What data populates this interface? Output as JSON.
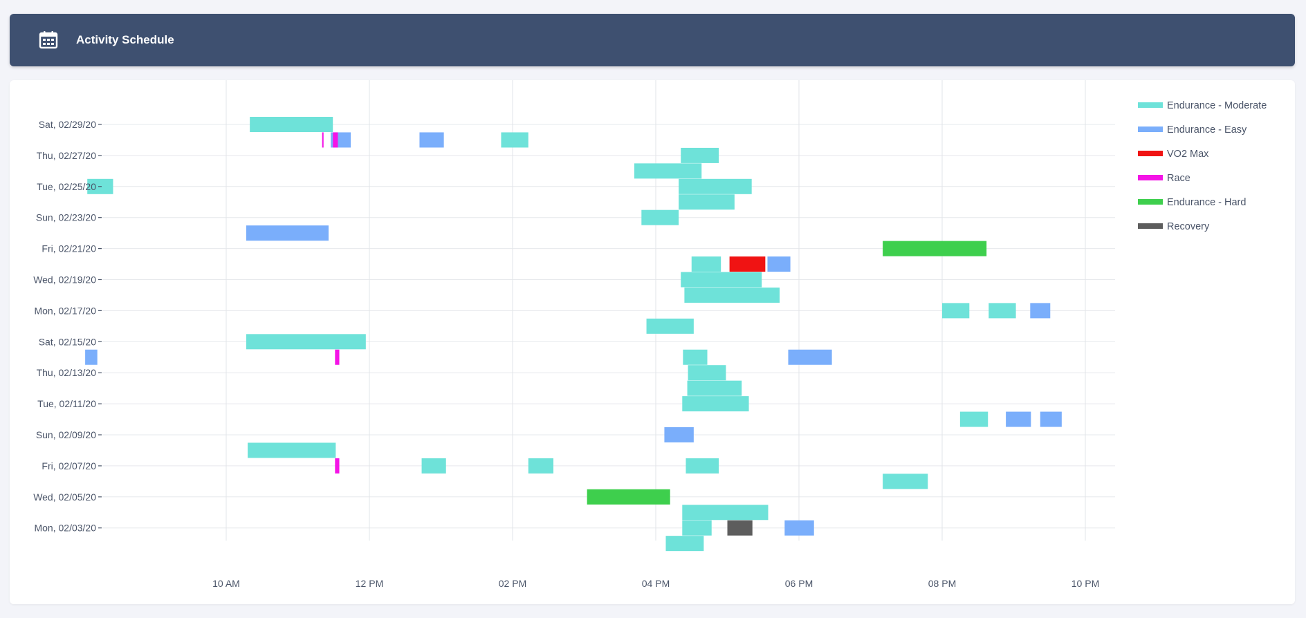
{
  "header": {
    "title": "Activity Schedule",
    "icon": "calendar-icon"
  },
  "chart_data": {
    "type": "timeline",
    "title": "",
    "xlabel": "",
    "ylabel": "",
    "x_unit": "hour of day",
    "x_ticks": [
      {
        "hour": 10,
        "label": "10 AM"
      },
      {
        "hour": 12,
        "label": "12 PM"
      },
      {
        "hour": 14,
        "label": "02 PM"
      },
      {
        "hour": 16,
        "label": "04 PM"
      },
      {
        "hour": 18,
        "label": "06 PM"
      },
      {
        "hour": 20,
        "label": "08 PM"
      },
      {
        "hour": 22,
        "label": "10 PM"
      }
    ],
    "xlim": [
      7,
      22.4
    ],
    "y_categories": [
      "Sat, 02/29/20",
      "Fri, 02/28/20",
      "Thu, 02/27/20",
      "Wed, 02/26/20",
      "Tue, 02/25/20",
      "Mon, 02/24/20",
      "Sun, 02/23/20",
      "Sat, 02/22/20",
      "Fri, 02/21/20",
      "Thu, 02/20/20",
      "Wed, 02/19/20",
      "Tue, 02/18/20",
      "Mon, 02/17/20",
      "Sun, 02/16/20",
      "Sat, 02/15/20",
      "Fri, 02/14/20",
      "Thu, 02/13/20",
      "Wed, 02/12/20",
      "Tue, 02/11/20",
      "Mon, 02/10/20",
      "Sun, 02/09/20",
      "Sat, 02/08/20",
      "Fri, 02/07/20",
      "Thu, 02/06/20",
      "Wed, 02/05/20",
      "Tue, 02/04/20",
      "Mon, 02/03/20",
      "Sun, 02/02/20"
    ],
    "y_tick_labels": [
      "Sat, 02/29/20",
      "Thu, 02/27/20",
      "Tue, 02/25/20",
      "Sun, 02/23/20",
      "Fri, 02/21/20",
      "Wed, 02/19/20",
      "Mon, 02/17/20",
      "Sat, 02/15/20",
      "Thu, 02/13/20",
      "Tue, 02/11/20",
      "Sun, 02/09/20",
      "Fri, 02/07/20",
      "Wed, 02/05/20",
      "Mon, 02/03/20"
    ],
    "legend_position": "right",
    "grid": true,
    "series": [
      {
        "name": "Endurance - Moderate",
        "color": "#6ee2d9"
      },
      {
        "name": "Endurance - Easy",
        "color": "#7aaefb"
      },
      {
        "name": "VO2 Max",
        "color": "#f01313"
      },
      {
        "name": "Race",
        "color": "#f414e6"
      },
      {
        "name": "Endurance - Hard",
        "color": "#3ecf4d"
      },
      {
        "name": "Recovery",
        "color": "#5d5d5d"
      }
    ],
    "activities": [
      {
        "date": "Sat, 02/29/20",
        "type": "Endurance - Moderate",
        "start": 10.33,
        "end": 11.49
      },
      {
        "date": "Fri, 02/28/20",
        "type": "Race",
        "start": 11.34,
        "end": 11.36
      },
      {
        "date": "Fri, 02/28/20",
        "type": "Endurance - Easy",
        "start": 11.46,
        "end": 11.74
      },
      {
        "date": "Fri, 02/28/20",
        "type": "Race",
        "start": 11.49,
        "end": 11.56
      },
      {
        "date": "Fri, 02/28/20",
        "type": "Endurance - Easy",
        "start": 12.7,
        "end": 13.04
      },
      {
        "date": "Fri, 02/28/20",
        "type": "Endurance - Moderate",
        "start": 13.84,
        "end": 14.22
      },
      {
        "date": "Thu, 02/27/20",
        "type": "Endurance - Moderate",
        "start": 16.35,
        "end": 16.88
      },
      {
        "date": "Wed, 02/26/20",
        "type": "Endurance - Moderate",
        "start": 15.7,
        "end": 16.64
      },
      {
        "date": "Tue, 02/25/20",
        "type": "Endurance - Moderate",
        "start": 8.06,
        "end": 8.42
      },
      {
        "date": "Tue, 02/25/20",
        "type": "Endurance - Moderate",
        "start": 16.32,
        "end": 17.34
      },
      {
        "date": "Mon, 02/24/20",
        "type": "Endurance - Moderate",
        "start": 16.32,
        "end": 17.1
      },
      {
        "date": "Sun, 02/23/20",
        "type": "Endurance - Moderate",
        "start": 15.8,
        "end": 16.32
      },
      {
        "date": "Sat, 02/22/20",
        "type": "Endurance - Easy",
        "start": 10.28,
        "end": 11.43
      },
      {
        "date": "Fri, 02/21/20",
        "type": "Endurance - Hard",
        "start": 19.17,
        "end": 20.62
      },
      {
        "date": "Thu, 02/20/20",
        "type": "Endurance - Moderate",
        "start": 16.5,
        "end": 16.91
      },
      {
        "date": "Thu, 02/20/20",
        "type": "VO2 Max",
        "start": 17.03,
        "end": 17.53
      },
      {
        "date": "Thu, 02/20/20",
        "type": "Endurance - Easy",
        "start": 17.56,
        "end": 17.88
      },
      {
        "date": "Wed, 02/19/20",
        "type": "Endurance - Moderate",
        "start": 16.35,
        "end": 17.48
      },
      {
        "date": "Tue, 02/18/20",
        "type": "Endurance - Moderate",
        "start": 16.4,
        "end": 17.73
      },
      {
        "date": "Mon, 02/17/20",
        "type": "Endurance - Moderate",
        "start": 20.0,
        "end": 20.38
      },
      {
        "date": "Mon, 02/17/20",
        "type": "Endurance - Moderate",
        "start": 20.65,
        "end": 21.03
      },
      {
        "date": "Mon, 02/17/20",
        "type": "Endurance - Easy",
        "start": 21.23,
        "end": 21.51
      },
      {
        "date": "Sun, 02/16/20",
        "type": "Endurance - Moderate",
        "start": 15.87,
        "end": 16.53
      },
      {
        "date": "Sat, 02/15/20",
        "type": "Endurance - Moderate",
        "start": 10.28,
        "end": 11.95
      },
      {
        "date": "Fri, 02/14/20",
        "type": "Endurance - Easy",
        "start": 8.03,
        "end": 8.2
      },
      {
        "date": "Fri, 02/14/20",
        "type": "Race",
        "start": 11.52,
        "end": 11.58
      },
      {
        "date": "Fri, 02/14/20",
        "type": "Endurance - Moderate",
        "start": 16.38,
        "end": 16.72
      },
      {
        "date": "Fri, 02/14/20",
        "type": "Endurance - Easy",
        "start": 17.85,
        "end": 18.46
      },
      {
        "date": "Thu, 02/13/20",
        "type": "Endurance - Moderate",
        "start": 16.45,
        "end": 16.98
      },
      {
        "date": "Wed, 02/12/20",
        "type": "Endurance - Moderate",
        "start": 16.44,
        "end": 17.2
      },
      {
        "date": "Tue, 02/11/20",
        "type": "Endurance - Moderate",
        "start": 16.37,
        "end": 17.3
      },
      {
        "date": "Mon, 02/10/20",
        "type": "Endurance - Moderate",
        "start": 20.25,
        "end": 20.64
      },
      {
        "date": "Mon, 02/10/20",
        "type": "Endurance - Easy",
        "start": 20.89,
        "end": 21.24
      },
      {
        "date": "Mon, 02/10/20",
        "type": "Endurance - Easy",
        "start": 21.37,
        "end": 21.67
      },
      {
        "date": "Sun, 02/09/20",
        "type": "Endurance - Easy",
        "start": 16.12,
        "end": 16.53
      },
      {
        "date": "Sat, 02/08/20",
        "type": "Endurance - Moderate",
        "start": 10.3,
        "end": 11.53
      },
      {
        "date": "Fri, 02/07/20",
        "type": "Race",
        "start": 11.52,
        "end": 11.58
      },
      {
        "date": "Fri, 02/07/20",
        "type": "Endurance - Moderate",
        "start": 12.73,
        "end": 13.07
      },
      {
        "date": "Fri, 02/07/20",
        "type": "Endurance - Moderate",
        "start": 14.22,
        "end": 14.57
      },
      {
        "date": "Fri, 02/07/20",
        "type": "Endurance - Moderate",
        "start": 16.42,
        "end": 16.88
      },
      {
        "date": "Thu, 02/06/20",
        "type": "Endurance - Moderate",
        "start": 19.17,
        "end": 19.8
      },
      {
        "date": "Wed, 02/05/20",
        "type": "Endurance - Hard",
        "start": 15.04,
        "end": 16.2
      },
      {
        "date": "Tue, 02/04/20",
        "type": "Endurance - Moderate",
        "start": 16.37,
        "end": 17.57
      },
      {
        "date": "Mon, 02/03/20",
        "type": "Endurance - Moderate",
        "start": 16.37,
        "end": 16.78
      },
      {
        "date": "Mon, 02/03/20",
        "type": "Recovery",
        "start": 17.0,
        "end": 17.35
      },
      {
        "date": "Mon, 02/03/20",
        "type": "Endurance - Easy",
        "start": 17.8,
        "end": 18.21
      },
      {
        "date": "Sun, 02/02/20",
        "type": "Endurance - Moderate",
        "start": 16.14,
        "end": 16.67
      }
    ]
  }
}
